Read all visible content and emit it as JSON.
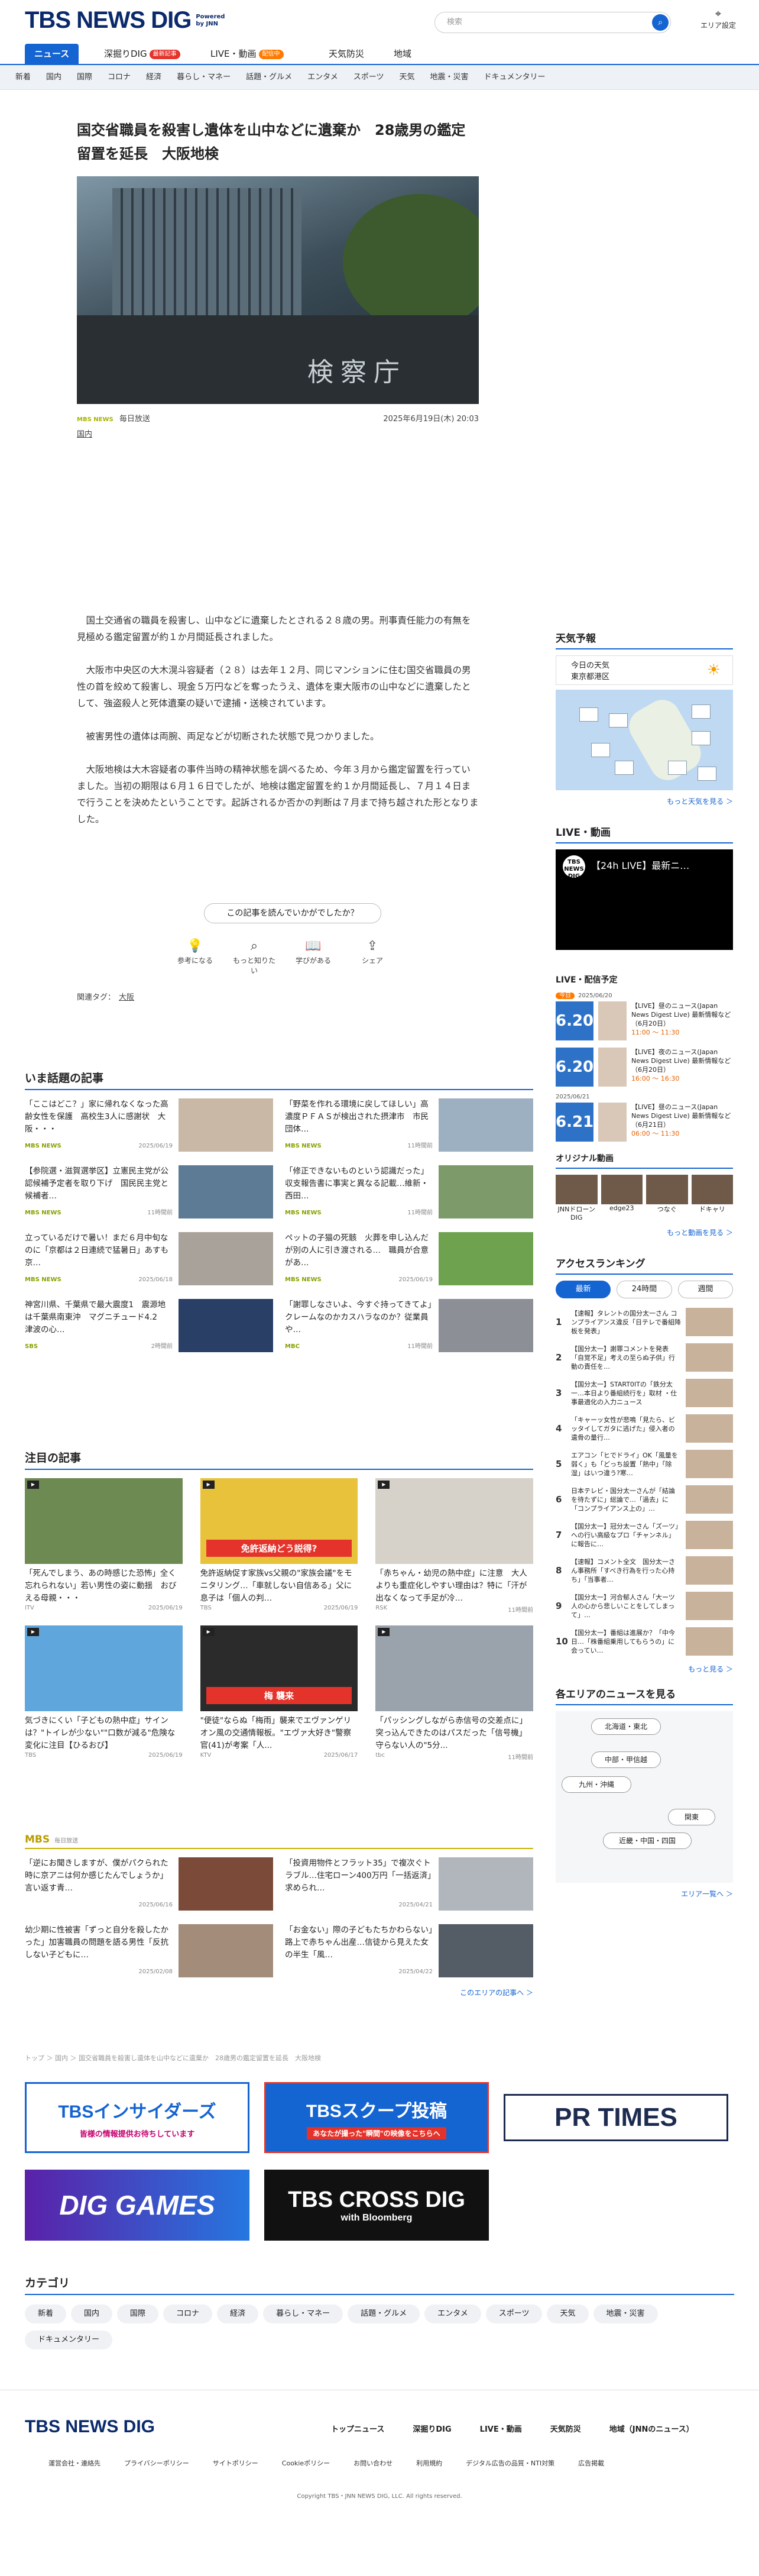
{
  "header": {
    "logo": "TBS NEWS DIG",
    "logo_sub1": "Powered",
    "logo_sub2": "by JNN",
    "search_placeholder": "検索",
    "area_label": "エリア設定"
  },
  "tabs": [
    {
      "label": "ニュース"
    },
    {
      "label": "深掘りDIG",
      "badge": "最新記事"
    },
    {
      "label": "LIVE・動画",
      "badge": "配信中"
    },
    {
      "label": "天気防災"
    },
    {
      "label": "地域"
    }
  ],
  "subnav": [
    "新着",
    "国内",
    "国際",
    "コロナ",
    "経済",
    "暮らし・マネー",
    "話題・グルメ",
    "エンタメ",
    "スポーツ",
    "天気",
    "地震・災害",
    "ドキュメンタリー"
  ],
  "article": {
    "headline": "国交省職員を殺害し遺体を山中などに遺棄か　28歳男の鑑定留置を延長　大阪地検",
    "hero_sign": "検察庁",
    "source_tag": "MBS NEWS",
    "source": "毎日放送",
    "date": "2025年6月19日(木) 20:03",
    "category": "国内",
    "body": [
      "国土交通省の職員を殺害し、山中などに遺棄したとされる２８歳の男。刑事責任能力の有無を見極める鑑定留置が約１か月間延長されました。",
      "大阪市中央区の大木滉斗容疑者（２８）は去年１２月、同じマンションに住む国交省職員の男性の首を絞めて殺害し、現金５万円などを奪ったうえ、遺体を東大阪市の山中などに遺棄したとして、強盗殺人と死体遺棄の疑いで逮捕・送検されています。",
      "被害男性の遺体は両腕、両足などが切断された状態で見つかりました。",
      "大阪地検は大木容疑者の事件当時の精神状態を調べるため、今年３月から鑑定留置を行っていました。当初の期限は６月１６日でしたが、地検は鑑定留置を約１か月間延長し、７月１４日まで行うことを決めたということです。起訴されるか否かの判断は７月まで持ち越された形となりました。"
    ],
    "ask": "この記事を読んでいかがでしたか？",
    "reactions": [
      "参考になる",
      "もっと知りたい",
      "学びがある",
      "シェア"
    ],
    "reltags_label": "関連タグ：",
    "reltag": "大阪"
  },
  "trending": {
    "title": "いま話題の記事",
    "items": [
      {
        "title": "「ここはどこ？」家に帰れなくなった高齢女性を保護　高校生3人に感謝状　大阪・・・",
        "src": "MBS NEWS",
        "time": "2025/06/19"
      },
      {
        "title": "「野菜を作れる環境に戻してほしい」高濃度ＰＦＡＳが検出された摂津市　市民団体…",
        "src": "MBS NEWS",
        "time": "11時間前"
      },
      {
        "title": "【参院選・滋賀選挙区】立憲民主党が公認候補予定者を取り下げ　国民民主党と候補者…",
        "src": "MBS NEWS",
        "time": "11時間前"
      },
      {
        "title": "「修正できないものという認識だった」収支報告書に事実と異なる記載…維新・西田…",
        "src": "MBS NEWS",
        "time": "11時間前"
      },
      {
        "title": "立っているだけで暑い！まだ６月中旬なのに「京都は２日連続で猛暑日」あすも京…",
        "src": "MBS NEWS",
        "time": "2025/06/18"
      },
      {
        "title": "ペットの子猫の死骸　火葬を申し込んだが別の人に引き渡される…　職員が合意があ…",
        "src": "MBS NEWS",
        "time": "2025/06/19"
      },
      {
        "title": "神宮川県、千葉県で最大震度1　震源地は千葉県南東沖　マグニチュード4.2　津波の心…",
        "src": "SBS",
        "time": "2時間前"
      },
      {
        "title": "「謝罪しなさいよ、今すぐ持ってきてよ」クレームなのかカスハラなのか？従業員や…",
        "src": "MBC",
        "time": "11時間前"
      }
    ]
  },
  "featured": {
    "title": "注目の記事",
    "items": [
      {
        "title": "「死んでしまう、あの時感じた恐怖」全く忘れられない」若い男性の姿に動揺　おびえる母親・・・",
        "src": "ITV",
        "time": "2025/06/19"
      },
      {
        "title": "免許返納促す家族vs父親の\"家族会議\"をモニタリング…「車就しない自信ある」父に息子は「個人の判…",
        "src": "TBS",
        "time": "2025/06/19",
        "overlay": "免許返納どう説得?"
      },
      {
        "title": "「赤ちゃん・幼児の熱中症」に注意　大人よりも重症化しやすい理由は？特に「汗が出なくなって手足が冷…",
        "src": "RSK",
        "time": "11時間前"
      },
      {
        "title": "気づきにくい「子どもの熱中症」サインは？\"トイレが少ない\"\"口数が減る\"危険な変化に注目【ひるおび】",
        "src": "TBS",
        "time": "2025/06/19"
      },
      {
        "title": "\"便徒\"ならぬ「梅雨」襲来でエヴァンゲリオン風の交通情報板。\"エヴァ大好き\"警察官(41)が考案「人...",
        "src": "KTV",
        "time": "2025/06/17",
        "overlay": "梅 襲来"
      },
      {
        "title": "「パッシングしながら赤信号の交差点に」突っ込んできたのはパスだった「信号機」守らない人の\"5分...",
        "src": "tbc",
        "time": "11時間前"
      }
    ]
  },
  "mbs": {
    "label": "MBS",
    "sub": "毎日放送",
    "items": [
      {
        "title": "「逆にお聞きしますが、僕がパクられた時に京アニは何か感じたんでしょうか」言い返す青…",
        "time": "2025/06/16"
      },
      {
        "title": "「投資用物件とフラット35」で複次ぐトラブル…住宅ローン400万円「一括返済」求められ…",
        "time": "2025/04/21"
      },
      {
        "title": "幼少期に性被害「ずっと自分を殺したかった」加害職員の問題を語る男性「反抗しない子どもに…",
        "time": "2025/02/08"
      },
      {
        "title": "「お金ない」際の子どもたちかわらない」路上で赤ちゃん出産…信徒から見えた女の半生「風…",
        "time": "2025/04/22"
      }
    ],
    "more": "このエリアの記事へ ＞"
  },
  "breadcrumb": "トップ ＞ 国内 ＞ 国交省職員を殺害し遺体を山中などに遺棄か　28歳男の鑑定留置を延長　大阪地検",
  "banners": [
    "TBSインサイダーズ",
    "皆様の情報提供お待ちしています",
    "TBSスクープ投稿",
    "あなたが撮った\"瞬間\"の映像をこちらへ",
    "PR TIMES",
    "DIG GAMES",
    "TBS CROSS DIG",
    "with Bloomberg"
  ],
  "sidebar": {
    "weather_title": "天気予報",
    "today": "今日の天気",
    "region": "東京都港区",
    "weather_more": "もっと天気を見る ＞",
    "live_title": "LIVE・動画",
    "live_video_title": "【24h LIVE】最新ニ…",
    "live_logo": "TBS NEWS DIG",
    "sched_title": "LIVE・配信予定",
    "sched": [
      {
        "head": "2025/06/20",
        "dbadge": "今日",
        "date": "6.20",
        "text": "【LIVE】昼のニュース(Japan News Digest Live) 最新情報など（6月20日）",
        "tm": "11:00 〜 11:30"
      },
      {
        "date": "6.20",
        "text": "【LIVE】夜のニュース(Japan News Digest Live) 最新情報など（6月20日）",
        "tm": "16:00 〜 16:30"
      },
      {
        "head": "2025/06/21",
        "date": "6.21",
        "text": "【LIVE】昼のニュース(Japan News Digest Live) 最新情報など（6月21日）",
        "tm": "06:00 〜 11:30"
      }
    ],
    "orig_title": "オリジナル動画",
    "orig": [
      "JNNドローンDIG",
      "edge23",
      "つなぐ",
      "ドキャリ"
    ],
    "orig_more": "もっと動画を見る ＞",
    "rank_title": "アクセスランキング",
    "rank_tabs": [
      "最新",
      "24時間",
      "週間"
    ],
    "rank": [
      "【速報】タレントの国分太一さん コンプライアンス違反「日テレで番組降板を発表」",
      "【国分太一】謝罪コメントを発表「自覚不足」考えの至らぬ子供」行動の責任を…",
      "【国分太一】START0ITの「鉄分太一…本日より番組続行を」取材 ・仕事最適化の入力ニュース",
      "「キャーッ女性が悲鳴「見たら、ビッタイしてガタに逃げた」侵入者の遺骨の量行…",
      "エアコン「ヒでドライ」OK「風量を弱く」も「どっち設置「熱中」「除湿」はいつ違う?寒…",
      "日本テレビ・国分太一さんが「結論を待たずに」総論で…「過去」に「コンプライアンス上の」…",
      "【国分太一】冠分太一さん「ズ一ツ」への行い高級なプロ「チャンネル」に報告に…",
      "【速報】コメント全文　国分太一さん事務所「すべき行為を行った心持ち」「当事者…",
      "【国分太一】河合郁人さん「大ーツ人の心から悲しいことをしてしまって」…",
      "【国分太一】番組は進展か？「中今日…「株番組乗用してもらうの」に会ってい…"
    ],
    "rank_more": "もっと見る ＞",
    "area_title": "各エリアのニュースを見る",
    "areas": [
      "北海道・東北",
      "中部・甲信越",
      "九州・沖縄",
      "関東",
      "近畿・中国・四国"
    ],
    "area_more": "エリア一覧へ ＞"
  },
  "categories": {
    "title": "カテゴリ",
    "chips": [
      "新着",
      "国内",
      "国際",
      "コロナ",
      "経済",
      "暮らし・マネー",
      "話題・グルメ",
      "エンタメ",
      "スポーツ",
      "天気",
      "地震・災害",
      "ドキュメンタリー"
    ]
  },
  "footer": {
    "logo": "TBS NEWS DIG",
    "nav": [
      "トップニュース",
      "深掘りDIG",
      "LIVE・動画",
      "天気防災",
      "地域（JNNのニュース）"
    ],
    "links": [
      "運営会社・連絡先",
      "プライバシーポリシー",
      "サイトポリシー",
      "Cookieポリシー",
      "お問い合わせ",
      "利用規約",
      "デジタル広告の品質・NTI対策",
      "広告掲載"
    ],
    "copy": "Copyright TBS・JNN NEWS DIG, LLC. All rights reserved."
  }
}
